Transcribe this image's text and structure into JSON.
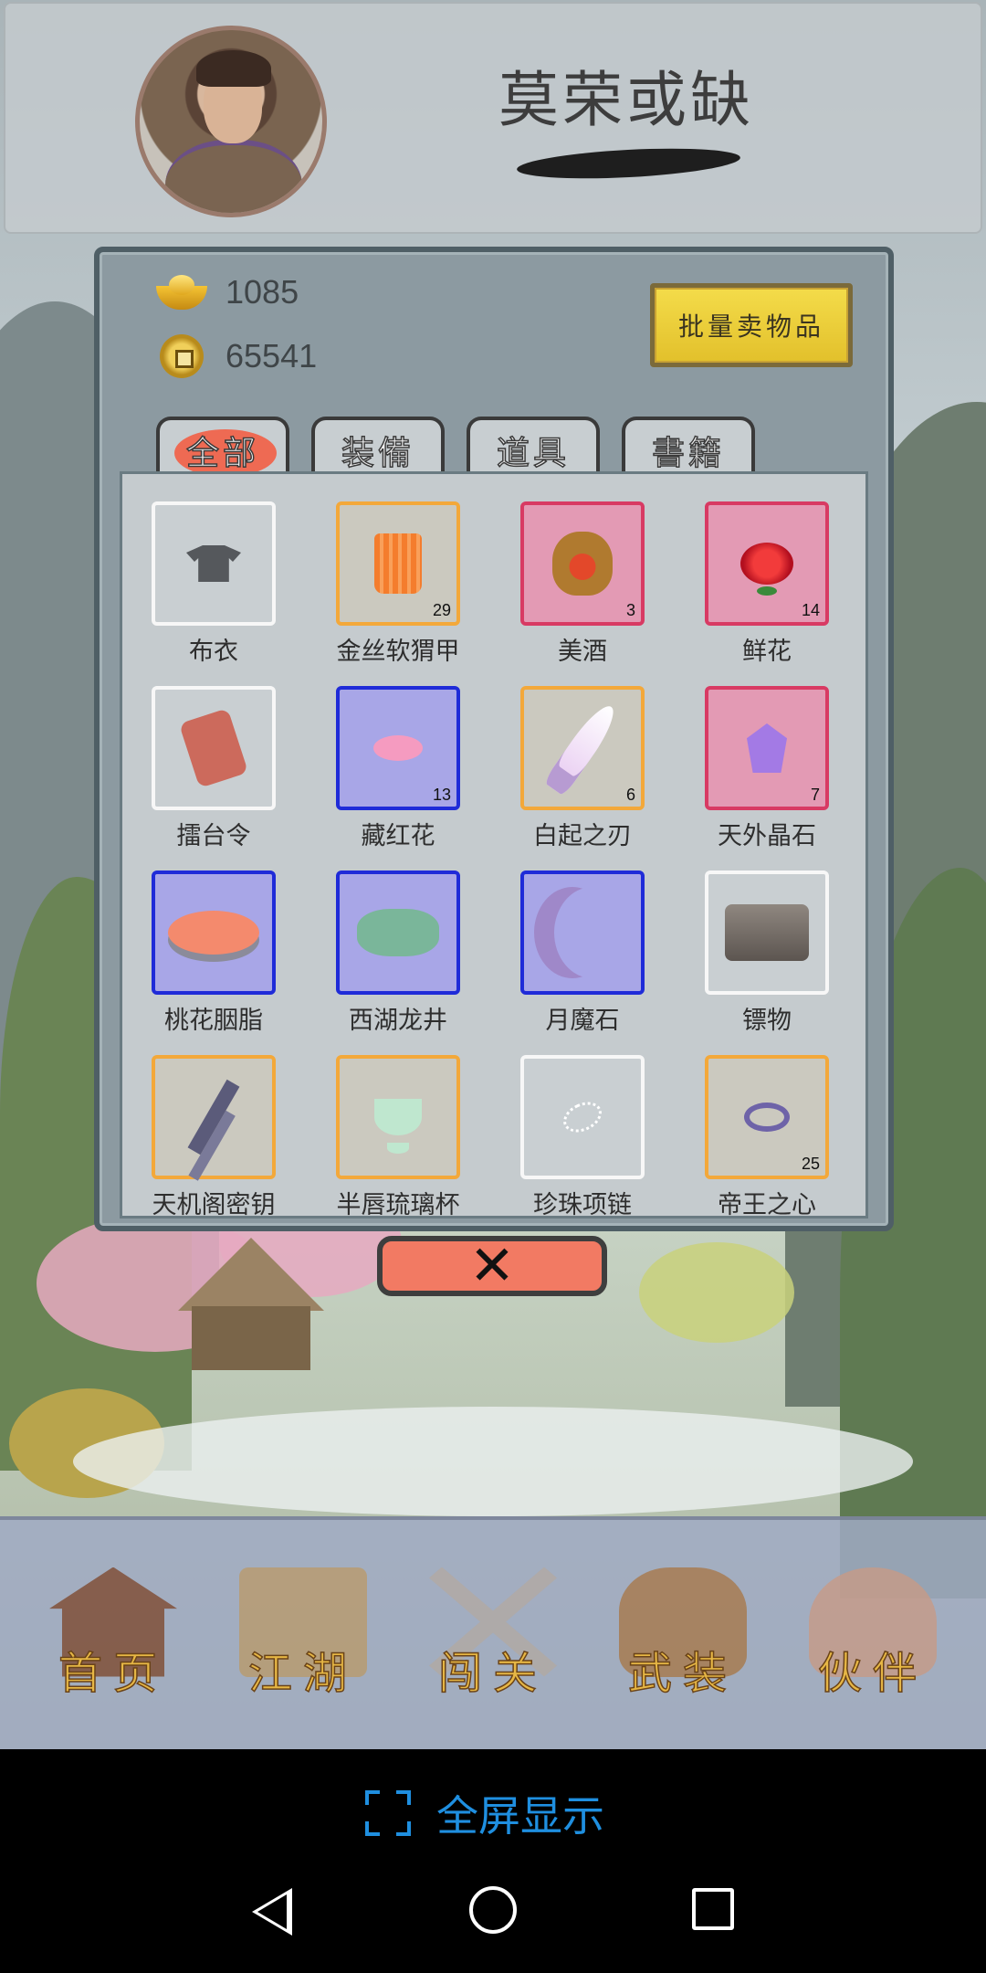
{
  "player": {
    "name": "莫荣或缺"
  },
  "currency": {
    "gold_ingots": "1085",
    "copper_coins": "65541"
  },
  "actions": {
    "bulk_sell_label": "批量卖物品",
    "close_label": "✕"
  },
  "tabs": [
    {
      "label": "全部",
      "active": true
    },
    {
      "label": "装備",
      "active": false
    },
    {
      "label": "道具",
      "active": false
    },
    {
      "label": "書籍",
      "active": false
    }
  ],
  "inventory": [
    {
      "name": "布衣",
      "count": "",
      "rarity": "white",
      "icon": "cloth-icon"
    },
    {
      "name": "金丝软猬甲",
      "count": "29",
      "rarity": "orange",
      "icon": "armor-icon"
    },
    {
      "name": "美酒",
      "count": "3",
      "rarity": "red",
      "icon": "wine-jar-icon"
    },
    {
      "name": "鲜花",
      "count": "14",
      "rarity": "red",
      "icon": "rose-icon"
    },
    {
      "name": "擂台令",
      "count": "",
      "rarity": "white",
      "icon": "token-icon"
    },
    {
      "name": "藏红花",
      "count": "13",
      "rarity": "blue",
      "icon": "saffron-icon"
    },
    {
      "name": "白起之刃",
      "count": "6",
      "rarity": "orange",
      "icon": "blade-icon"
    },
    {
      "name": "天外晶石",
      "count": "7",
      "rarity": "red",
      "icon": "crystal-icon"
    },
    {
      "name": "桃花胭脂",
      "count": "",
      "rarity": "blue",
      "icon": "rouge-icon"
    },
    {
      "name": "西湖龙井",
      "count": "",
      "rarity": "blue",
      "icon": "tea-icon"
    },
    {
      "name": "月魔石",
      "count": "",
      "rarity": "blue",
      "icon": "moonstone-icon"
    },
    {
      "name": "镖物",
      "count": "",
      "rarity": "white",
      "icon": "cargo-box-icon"
    },
    {
      "name": "天机阁密钥",
      "count": "",
      "rarity": "orange",
      "icon": "key-icon"
    },
    {
      "name": "半唇琉璃杯",
      "count": "",
      "rarity": "orange",
      "icon": "glass-cup-icon"
    },
    {
      "name": "珍珠项链",
      "count": "",
      "rarity": "white",
      "icon": "necklace-icon"
    },
    {
      "name": "帝王之心",
      "count": "25",
      "rarity": "orange",
      "icon": "ring-icon"
    }
  ],
  "rarity_colors": {
    "white": "#f7f7f7",
    "orange": "#f3a83a",
    "red": "#d83a63",
    "blue": "#1f2bd8"
  },
  "bottom_nav": [
    {
      "label": "首页",
      "icon": "temple-icon"
    },
    {
      "label": "江湖",
      "icon": "scroll-map-icon"
    },
    {
      "label": "闯关",
      "icon": "crossed-swords-icon"
    },
    {
      "label": "武装",
      "icon": "armor-book-icon"
    },
    {
      "label": "伙伴",
      "icon": "partners-icon"
    }
  ],
  "system": {
    "fullscreen_label": "全屏显示",
    "accent_color": "#1f8fe0"
  }
}
